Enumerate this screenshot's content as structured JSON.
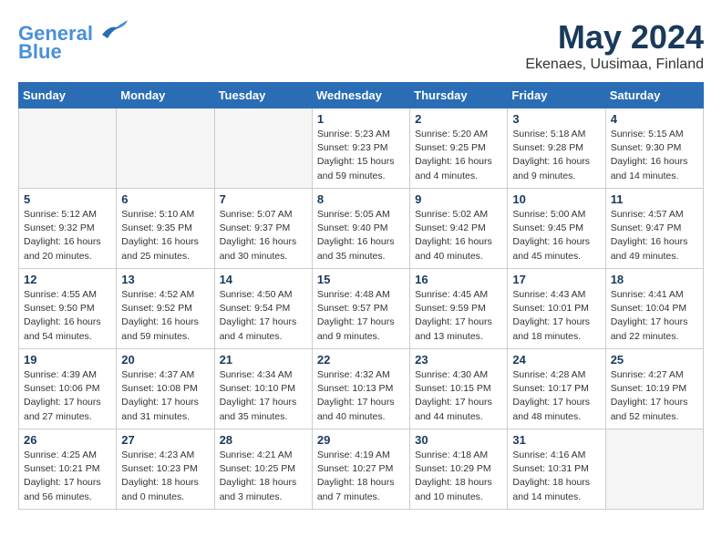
{
  "header": {
    "logo_line1": "General",
    "logo_line2": "Blue",
    "month": "May 2024",
    "location": "Ekenaes, Uusimaa, Finland"
  },
  "days_of_week": [
    "Sunday",
    "Monday",
    "Tuesday",
    "Wednesday",
    "Thursday",
    "Friday",
    "Saturday"
  ],
  "weeks": [
    [
      {
        "day": "",
        "info": "",
        "empty": true
      },
      {
        "day": "",
        "info": "",
        "empty": true
      },
      {
        "day": "",
        "info": "",
        "empty": true
      },
      {
        "day": "1",
        "info": "Sunrise: 5:23 AM\nSunset: 9:23 PM\nDaylight: 15 hours\nand 59 minutes."
      },
      {
        "day": "2",
        "info": "Sunrise: 5:20 AM\nSunset: 9:25 PM\nDaylight: 16 hours\nand 4 minutes."
      },
      {
        "day": "3",
        "info": "Sunrise: 5:18 AM\nSunset: 9:28 PM\nDaylight: 16 hours\nand 9 minutes."
      },
      {
        "day": "4",
        "info": "Sunrise: 5:15 AM\nSunset: 9:30 PM\nDaylight: 16 hours\nand 14 minutes."
      }
    ],
    [
      {
        "day": "5",
        "info": "Sunrise: 5:12 AM\nSunset: 9:32 PM\nDaylight: 16 hours\nand 20 minutes."
      },
      {
        "day": "6",
        "info": "Sunrise: 5:10 AM\nSunset: 9:35 PM\nDaylight: 16 hours\nand 25 minutes."
      },
      {
        "day": "7",
        "info": "Sunrise: 5:07 AM\nSunset: 9:37 PM\nDaylight: 16 hours\nand 30 minutes."
      },
      {
        "day": "8",
        "info": "Sunrise: 5:05 AM\nSunset: 9:40 PM\nDaylight: 16 hours\nand 35 minutes."
      },
      {
        "day": "9",
        "info": "Sunrise: 5:02 AM\nSunset: 9:42 PM\nDaylight: 16 hours\nand 40 minutes."
      },
      {
        "day": "10",
        "info": "Sunrise: 5:00 AM\nSunset: 9:45 PM\nDaylight: 16 hours\nand 45 minutes."
      },
      {
        "day": "11",
        "info": "Sunrise: 4:57 AM\nSunset: 9:47 PM\nDaylight: 16 hours\nand 49 minutes."
      }
    ],
    [
      {
        "day": "12",
        "info": "Sunrise: 4:55 AM\nSunset: 9:50 PM\nDaylight: 16 hours\nand 54 minutes."
      },
      {
        "day": "13",
        "info": "Sunrise: 4:52 AM\nSunset: 9:52 PM\nDaylight: 16 hours\nand 59 minutes."
      },
      {
        "day": "14",
        "info": "Sunrise: 4:50 AM\nSunset: 9:54 PM\nDaylight: 17 hours\nand 4 minutes."
      },
      {
        "day": "15",
        "info": "Sunrise: 4:48 AM\nSunset: 9:57 PM\nDaylight: 17 hours\nand 9 minutes."
      },
      {
        "day": "16",
        "info": "Sunrise: 4:45 AM\nSunset: 9:59 PM\nDaylight: 17 hours\nand 13 minutes."
      },
      {
        "day": "17",
        "info": "Sunrise: 4:43 AM\nSunset: 10:01 PM\nDaylight: 17 hours\nand 18 minutes."
      },
      {
        "day": "18",
        "info": "Sunrise: 4:41 AM\nSunset: 10:04 PM\nDaylight: 17 hours\nand 22 minutes."
      }
    ],
    [
      {
        "day": "19",
        "info": "Sunrise: 4:39 AM\nSunset: 10:06 PM\nDaylight: 17 hours\nand 27 minutes."
      },
      {
        "day": "20",
        "info": "Sunrise: 4:37 AM\nSunset: 10:08 PM\nDaylight: 17 hours\nand 31 minutes."
      },
      {
        "day": "21",
        "info": "Sunrise: 4:34 AM\nSunset: 10:10 PM\nDaylight: 17 hours\nand 35 minutes."
      },
      {
        "day": "22",
        "info": "Sunrise: 4:32 AM\nSunset: 10:13 PM\nDaylight: 17 hours\nand 40 minutes."
      },
      {
        "day": "23",
        "info": "Sunrise: 4:30 AM\nSunset: 10:15 PM\nDaylight: 17 hours\nand 44 minutes."
      },
      {
        "day": "24",
        "info": "Sunrise: 4:28 AM\nSunset: 10:17 PM\nDaylight: 17 hours\nand 48 minutes."
      },
      {
        "day": "25",
        "info": "Sunrise: 4:27 AM\nSunset: 10:19 PM\nDaylight: 17 hours\nand 52 minutes."
      }
    ],
    [
      {
        "day": "26",
        "info": "Sunrise: 4:25 AM\nSunset: 10:21 PM\nDaylight: 17 hours\nand 56 minutes."
      },
      {
        "day": "27",
        "info": "Sunrise: 4:23 AM\nSunset: 10:23 PM\nDaylight: 18 hours\nand 0 minutes."
      },
      {
        "day": "28",
        "info": "Sunrise: 4:21 AM\nSunset: 10:25 PM\nDaylight: 18 hours\nand 3 minutes."
      },
      {
        "day": "29",
        "info": "Sunrise: 4:19 AM\nSunset: 10:27 PM\nDaylight: 18 hours\nand 7 minutes."
      },
      {
        "day": "30",
        "info": "Sunrise: 4:18 AM\nSunset: 10:29 PM\nDaylight: 18 hours\nand 10 minutes."
      },
      {
        "day": "31",
        "info": "Sunrise: 4:16 AM\nSunset: 10:31 PM\nDaylight: 18 hours\nand 14 minutes."
      },
      {
        "day": "",
        "info": "",
        "empty": true
      }
    ]
  ]
}
